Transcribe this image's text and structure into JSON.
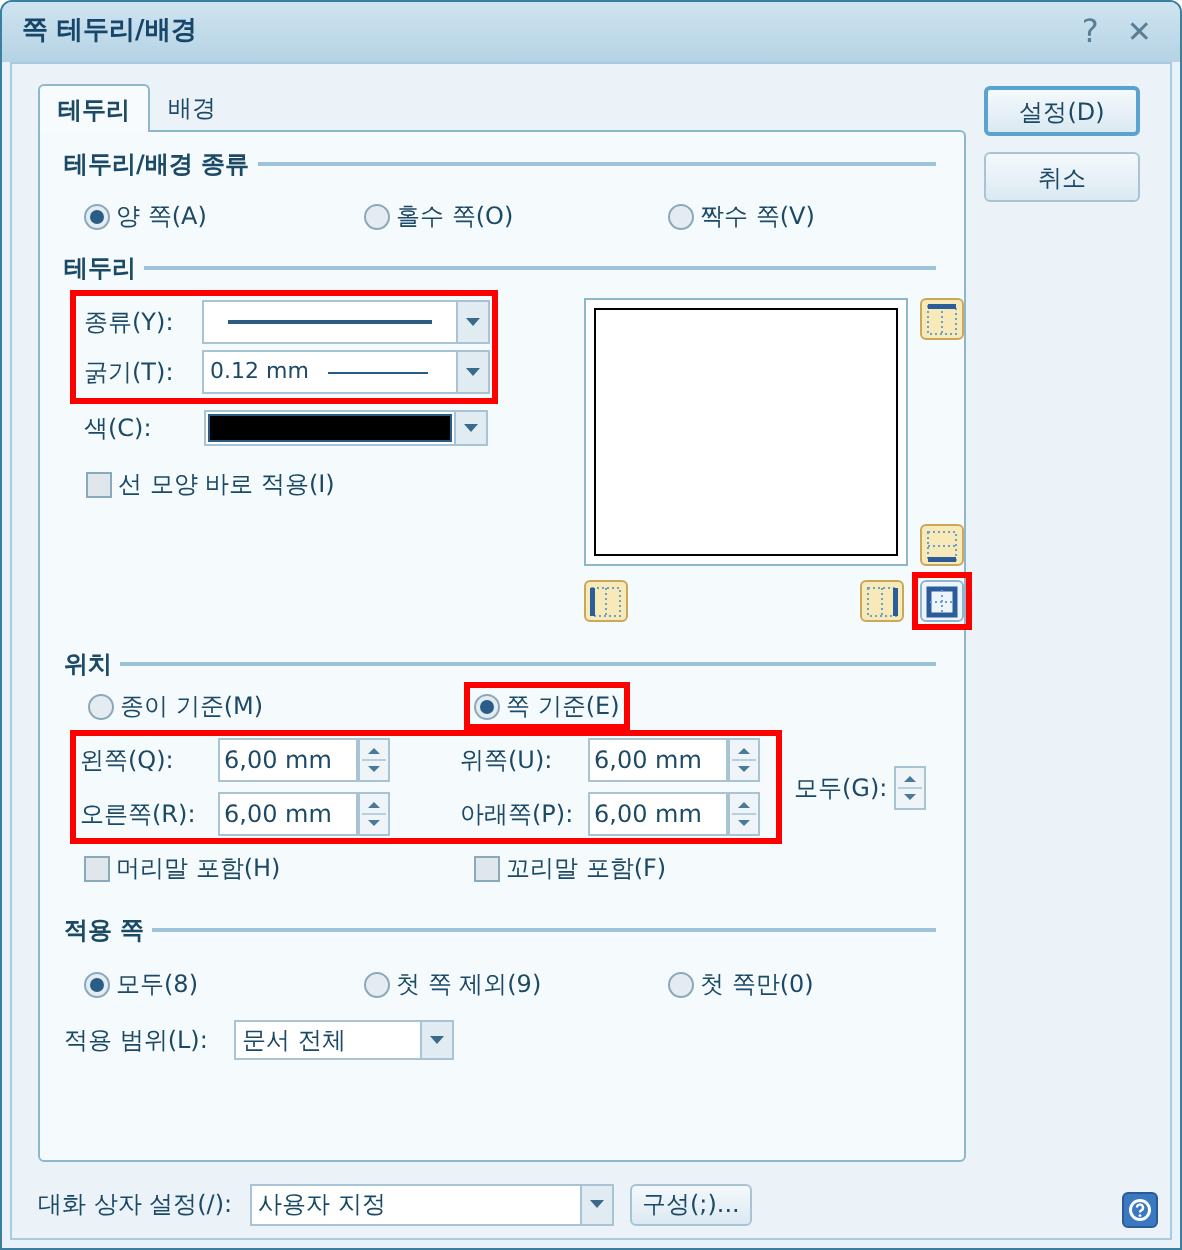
{
  "window": {
    "title": "쪽 테두리/배경",
    "help": "?",
    "close": "✕"
  },
  "tabs": [
    {
      "label": "테두리",
      "selected": true
    },
    {
      "label": "배경",
      "selected": false
    }
  ],
  "buttons": [
    {
      "label": "설정(D)",
      "default": true
    },
    {
      "label": "취소",
      "default": false
    }
  ],
  "page_type": {
    "title": "테두리/배경 종류",
    "options": [
      {
        "label": "양 쪽(A)",
        "selected": true
      },
      {
        "label": "홀수 쪽(O)",
        "selected": false
      },
      {
        "label": "짝수 쪽(V)",
        "selected": false
      }
    ]
  },
  "border": {
    "title": "테두리",
    "highlighted": true,
    "type_label": "종류(Y):",
    "thickness_label": "굵기(T):",
    "thickness_value": "0.12 mm",
    "color_label": "색(C):",
    "color": "#000000",
    "apply_now": {
      "label": "선 모양 바로 적용(I)",
      "checked": false
    },
    "all_button_highlighted": true,
    "side_buttons": [
      {
        "kind": "top",
        "selected": false
      },
      {
        "kind": "bottom",
        "selected": false
      },
      {
        "kind": "left",
        "selected": false
      },
      {
        "kind": "right",
        "selected": false
      },
      {
        "kind": "all",
        "selected": true
      }
    ]
  },
  "position": {
    "title": "위치",
    "options": [
      {
        "label": "종이 기준(M)",
        "selected": false,
        "highlighted": false
      },
      {
        "label": "쪽 기준(E)",
        "selected": true,
        "highlighted": true
      }
    ],
    "margins_highlighted": true,
    "margins": [
      {
        "label": "왼쪽(Q):",
        "value": "6,00 mm"
      },
      {
        "label": "위쪽(U):",
        "value": "6,00 mm"
      },
      {
        "label": "오른쪽(R):",
        "value": "6,00 mm"
      },
      {
        "label": "아래쪽(P):",
        "value": "6,00 mm"
      }
    ],
    "all_label": "모두(G):",
    "checkboxes": [
      {
        "label": "머리말 포함(H)",
        "checked": false
      },
      {
        "label": "꼬리말 포함(F)",
        "checked": false
      }
    ]
  },
  "apply_pages": {
    "title": "적용 쪽",
    "options": [
      {
        "label": "모두(8)",
        "selected": true
      },
      {
        "label": "첫 쪽 제외(9)",
        "selected": false
      },
      {
        "label": "첫 쪽만(0)",
        "selected": false
      }
    ],
    "range_label": "적용 범위(L):",
    "range_value": "문서 전체"
  },
  "footer": {
    "label": "대화 상자 설정(/):",
    "value": "사용자 지정",
    "button": "구성(;)..."
  }
}
